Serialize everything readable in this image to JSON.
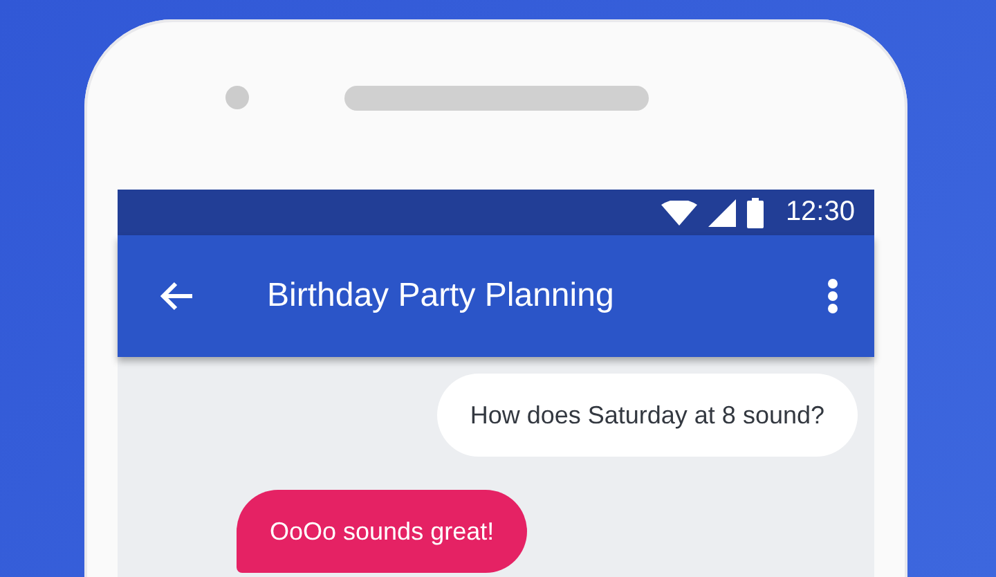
{
  "status_bar": {
    "time": "12:30"
  },
  "toolbar": {
    "title": "Birthday Party Planning"
  },
  "messages": [
    {
      "kind": "sent",
      "text": "How does Saturday at 8 sound?"
    },
    {
      "kind": "received",
      "text": "OoOo sounds great!"
    }
  ]
}
